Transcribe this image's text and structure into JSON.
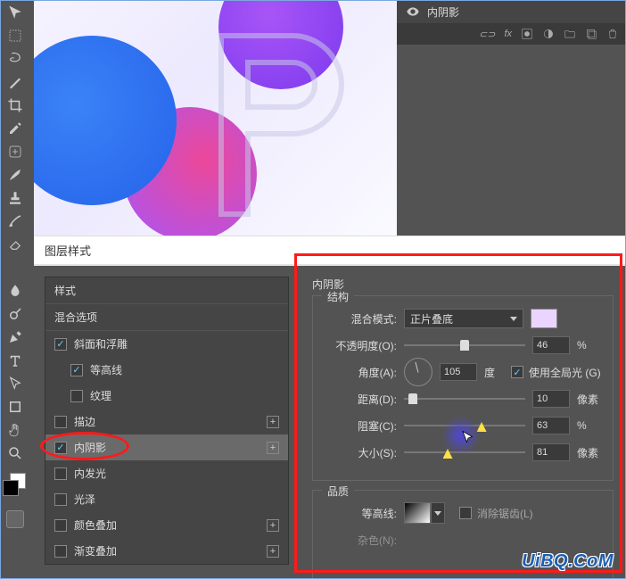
{
  "layers": {
    "visible_effect": "内阴影",
    "footer_fx": "fx"
  },
  "dialog_title": "图层样式",
  "styles": {
    "header": "样式",
    "blend_options": "混合选项",
    "items": [
      {
        "label": "斜面和浮雕",
        "checked": true
      },
      {
        "label": "等高线",
        "checked": true
      },
      {
        "label": "纹理",
        "checked": false
      },
      {
        "label": "描边",
        "checked": false
      },
      {
        "label": "内阴影",
        "checked": true
      },
      {
        "label": "内发光",
        "checked": false
      },
      {
        "label": "光泽",
        "checked": false
      },
      {
        "label": "颜色叠加",
        "checked": false
      },
      {
        "label": "渐变叠加",
        "checked": false
      }
    ]
  },
  "panel": {
    "title": "内阴影",
    "structure_title": "结构",
    "blend_mode_label": "混合模式:",
    "blend_mode_value": "正片叠底",
    "opacity_label": "不透明度(O):",
    "opacity_value": "46",
    "opacity_unit": "%",
    "angle_label": "角度(A):",
    "angle_value": "105",
    "angle_unit": "度",
    "global_light_label": "使用全局光 (G)",
    "distance_label": "距离(D):",
    "distance_value": "10",
    "distance_unit": "像素",
    "choke_label": "阻塞(C):",
    "choke_value": "63",
    "choke_unit": "%",
    "size_label": "大小(S):",
    "size_value": "81",
    "size_unit": "像素",
    "quality_title": "品质",
    "contour_label": "等高线:",
    "antialias_label": "消除锯齿(L)",
    "noise_label": "杂色(N):"
  },
  "watermark": "UiBQ.CoM",
  "colors": {
    "accent_red": "#ff1a1a",
    "swatch": "#e9d5ff"
  }
}
